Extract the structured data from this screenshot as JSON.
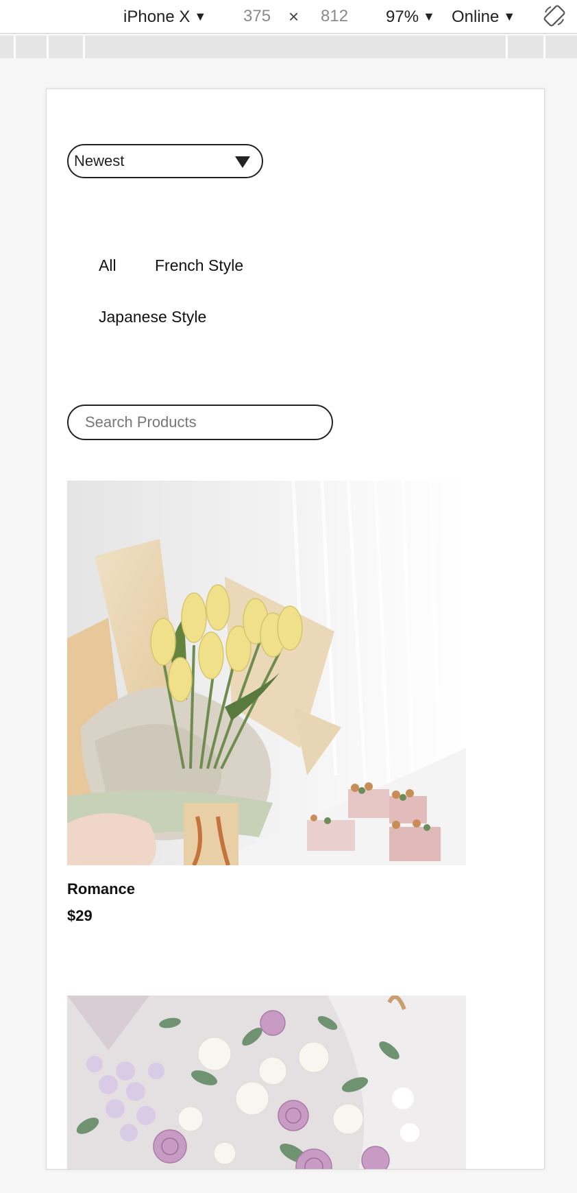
{
  "toolbar": {
    "device": "iPhone X",
    "width": "375",
    "times": "×",
    "height": "812",
    "zoom": "97%",
    "network": "Online",
    "caret": "▼"
  },
  "page": {
    "sort": {
      "selected": "Newest"
    },
    "categories": [
      "All",
      "French Style",
      "Japanese Style"
    ],
    "search": {
      "placeholder": "Search Products"
    },
    "products": [
      {
        "name": "Romance",
        "price": "$29"
      },
      {
        "name": "",
        "price": ""
      }
    ]
  },
  "colors": {
    "accent": "#222222",
    "toolbar_bg": "#ffffff",
    "ruler_bg": "#e5e5e5",
    "page_bg": "#f6f6f6"
  },
  "icons": [
    "caret-down-icon",
    "close-x-icon",
    "rotate-device-icon",
    "dropdown-triangle-icon"
  ]
}
